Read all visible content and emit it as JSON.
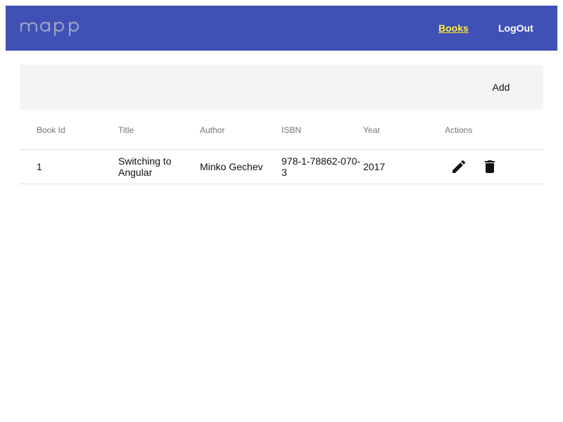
{
  "app": {
    "logo": "mapp"
  },
  "nav": {
    "books": "Books",
    "logout": "LogOut"
  },
  "toolbar": {
    "add_label": "Add"
  },
  "table": {
    "headers": [
      "Book Id",
      "Title",
      "Author",
      "ISBN",
      "Year",
      "Actions"
    ],
    "rows": [
      {
        "id": "1",
        "title": "Switching to Angular",
        "author": "Minko Gechev",
        "isbn": "978-1-78862-070-3",
        "year": "2017"
      }
    ]
  },
  "icons": {
    "edit": "edit-icon",
    "delete": "delete-icon"
  },
  "colors": {
    "navbar": "#3f51b5",
    "active_link": "#ffeb3b",
    "toolbar_bg": "#f4f4f4"
  }
}
